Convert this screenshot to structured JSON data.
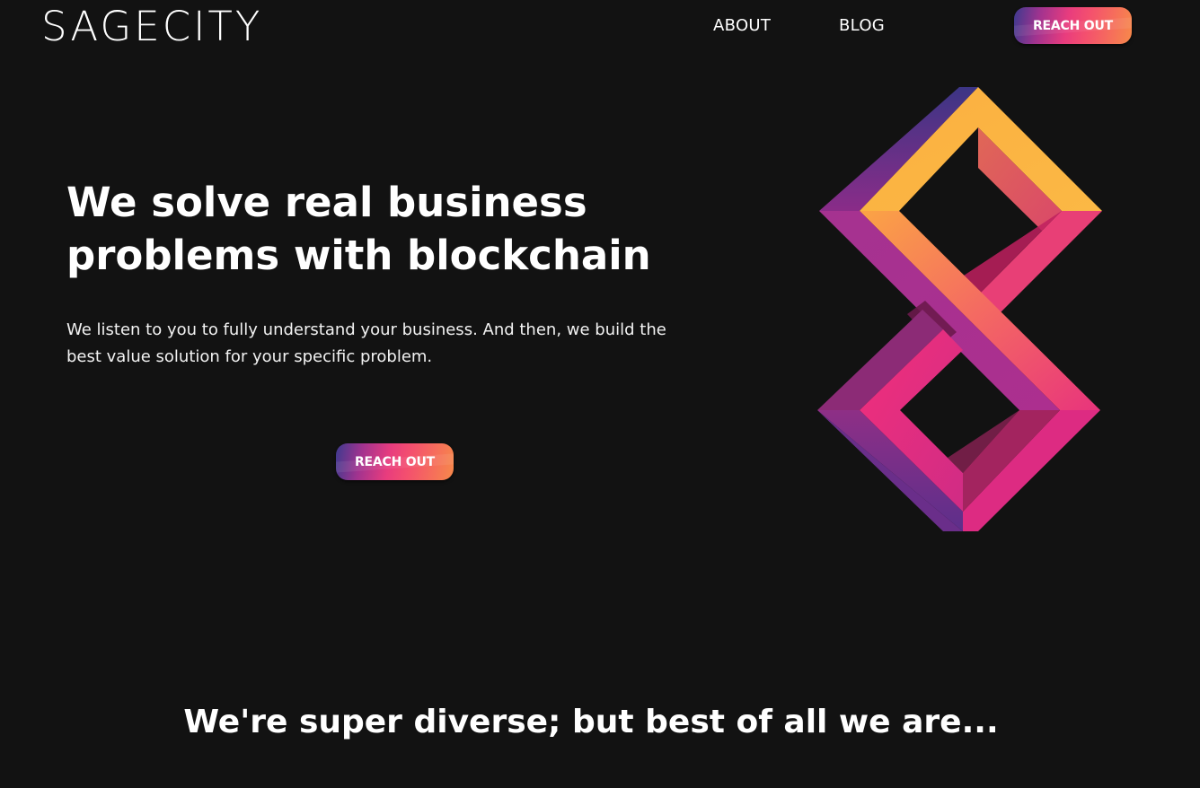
{
  "header": {
    "logo_text": "SAGECITY",
    "nav": {
      "about_label": "ABOUT",
      "blog_label": "BLOG"
    },
    "cta_label": "REACH OUT"
  },
  "hero": {
    "title": "We solve real business problems with blockchain",
    "subtitle": "We listen to you to fully understand your business. And then, we build the best value solution for your specific problem.",
    "cta_label": "REACH OUT",
    "graphic_icon": "interlocking-infinity-logo-icon"
  },
  "section": {
    "title": "We're super diverse; but best of all we are..."
  },
  "colors": {
    "background": "#121212",
    "text": "#ffffff",
    "gradient_start": "#3d3a8f",
    "gradient_mid": "#e83c7e",
    "gradient_end": "#f7894a",
    "graphic_yellow": "#fbb040",
    "graphic_pink": "#f0307a",
    "graphic_purple": "#7a2e86"
  }
}
